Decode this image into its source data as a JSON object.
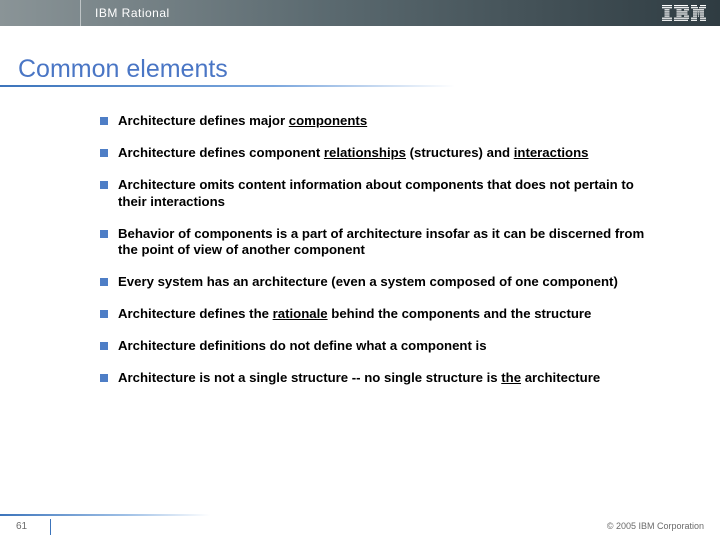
{
  "banner": {
    "product": "IBM Rational"
  },
  "title": "Common elements",
  "bullets": [
    {
      "a": "Architecture defines major ",
      "b": "components",
      "c": ""
    },
    {
      "a": "Architecture defines component ",
      "b": "relationships",
      "c": " (structures) and ",
      "d": "interactions",
      "e": ""
    },
    {
      "a": "Architecture omits content information about components that does not pertain to their interactions"
    },
    {
      "a": "Behavior of components is a part of architecture insofar as it can be discerned from the point of view of another component"
    },
    {
      "a": "Every system has an architecture (even a system composed of one component)"
    },
    {
      "a": "Architecture defines the ",
      "b": "rationale",
      "c": " behind the components and the structure"
    },
    {
      "a": "Architecture definitions do not define what a component is"
    },
    {
      "a": "Architecture is not a single structure -- no single structure is ",
      "b": "the",
      "c": " architecture"
    }
  ],
  "footer": {
    "page": "61",
    "copyright": "© 2005 IBM Corporation"
  }
}
